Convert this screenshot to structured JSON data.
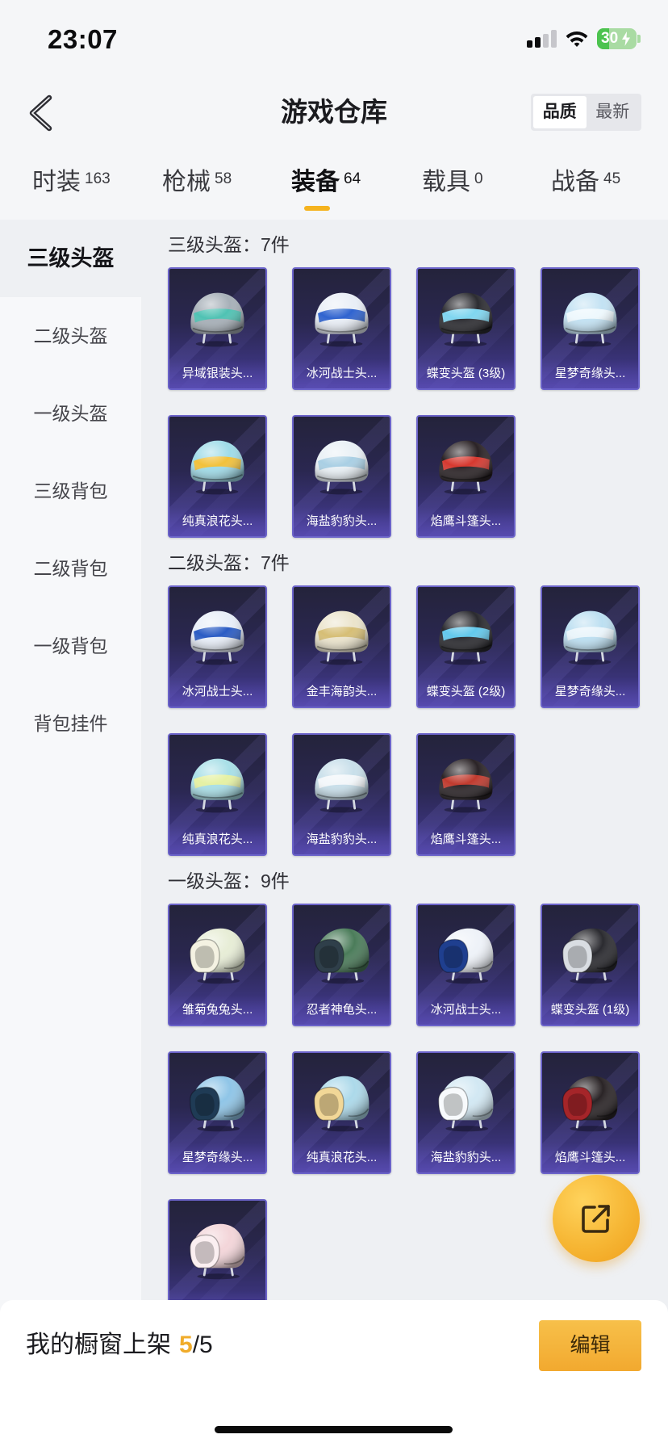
{
  "status_bar": {
    "time": "23:07",
    "battery_level": "30",
    "signal_bars": 2,
    "icons": [
      "cellular-signal-icon",
      "wifi-icon",
      "battery-charging-icon"
    ]
  },
  "header": {
    "title": "游戏仓库",
    "back_icon": "chevron-left-icon",
    "sort_options": [
      {
        "label": "品质",
        "selected": true
      },
      {
        "label": "最新",
        "selected": false
      }
    ]
  },
  "tabs": [
    {
      "label": "时装",
      "count": "163",
      "active": false
    },
    {
      "label": "枪械",
      "count": "58",
      "active": false
    },
    {
      "label": "装备",
      "count": "64",
      "active": true
    },
    {
      "label": "载具",
      "count": "0",
      "active": false
    },
    {
      "label": "战备",
      "count": "45",
      "active": false
    }
  ],
  "sidebar": {
    "items": [
      {
        "label": "三级头盔",
        "active": true
      },
      {
        "label": "二级头盔",
        "active": false
      },
      {
        "label": "一级头盔",
        "active": false
      },
      {
        "label": "三级背包",
        "active": false
      },
      {
        "label": "二级背包",
        "active": false
      },
      {
        "label": "一级背包",
        "active": false
      },
      {
        "label": "背包挂件",
        "active": false
      }
    ]
  },
  "sections": [
    {
      "title": "三级头盔：7件",
      "helmet_style": "visor",
      "items": [
        {
          "name": "异域银装头...",
          "colors": [
            "#a7b0b8",
            "#4fc2b3"
          ]
        },
        {
          "name": "冰河战士头...",
          "colors": [
            "#e9eef6",
            "#2f63cf"
          ]
        },
        {
          "name": "蝶变头盔 (3级)",
          "colors": [
            "#2c2c31",
            "#7fd6f0"
          ]
        },
        {
          "name": "星梦奇缘头...",
          "colors": [
            "#c3e2f3",
            "#eef8fd"
          ]
        },
        {
          "name": "纯真浪花头...",
          "colors": [
            "#9fdbe8",
            "#f2c13b"
          ]
        },
        {
          "name": "海盐豹豹头...",
          "colors": [
            "#e9f0f5",
            "#a9cfe4"
          ]
        },
        {
          "name": "焰鹰斗篷头...",
          "colors": [
            "#2b2326",
            "#d6382f"
          ]
        }
      ]
    },
    {
      "title": "二级头盔：7件",
      "helmet_style": "visor",
      "items": [
        {
          "name": "冰河战士头...",
          "colors": [
            "#e8eef8",
            "#2a5bc4"
          ]
        },
        {
          "name": "金丰海韵头...",
          "colors": [
            "#ebe4cc",
            "#d6be75"
          ]
        },
        {
          "name": "蝶变头盔 (2级)",
          "colors": [
            "#2a2a2f",
            "#62c8ec"
          ]
        },
        {
          "name": "星梦奇缘头...",
          "colors": [
            "#bcdff1",
            "#eaf5fb"
          ]
        },
        {
          "name": "纯真浪花头...",
          "colors": [
            "#a8dfe7",
            "#e5f1a3"
          ]
        },
        {
          "name": "海盐豹豹头...",
          "colors": [
            "#c8dfea",
            "#f3f7fa"
          ]
        },
        {
          "name": "焰鹰斗篷头...",
          "colors": [
            "#2b2427",
            "#c03a2e"
          ]
        }
      ]
    },
    {
      "title": "一级头盔：9件",
      "helmet_style": "open-face",
      "items": [
        {
          "name": "雏菊兔兔头...",
          "colors": [
            "#e7edd6",
            "#f4f2e2"
          ]
        },
        {
          "name": "忍者神龟头...",
          "colors": [
            "#4b7c5a",
            "#2f3f4a"
          ]
        },
        {
          "name": "冰河战士头...",
          "colors": [
            "#eef2f8",
            "#1f3f8f"
          ]
        },
        {
          "name": "蝶变头盔 (1级)",
          "colors": [
            "#2b2b30",
            "#d9dde2"
          ]
        },
        {
          "name": "星梦奇缘头...",
          "colors": [
            "#8fc5e7",
            "#1f3b55"
          ]
        },
        {
          "name": "纯真浪花头...",
          "colors": [
            "#acd9ea",
            "#f1d797"
          ]
        },
        {
          "name": "海盐豹豹头...",
          "colors": [
            "#d2e8f3",
            "#f7fafc"
          ]
        },
        {
          "name": "焰鹰斗篷头...",
          "colors": [
            "#2a2426",
            "#a52529"
          ]
        },
        {
          "colors": [
            "#f3d5d9",
            "#fbeff1"
          ]
        }
      ]
    }
  ],
  "fab": {
    "icon": "share-external-icon"
  },
  "footer": {
    "label": "我的橱窗上架",
    "shelf_count": "5",
    "shelf_total": "/5",
    "edit_button": "编辑"
  },
  "theme": {
    "accent": "#f5b31f",
    "count_highlight": "#f0ac2b",
    "card_border": "#6b63c9",
    "content_background": "#eef0f3"
  }
}
